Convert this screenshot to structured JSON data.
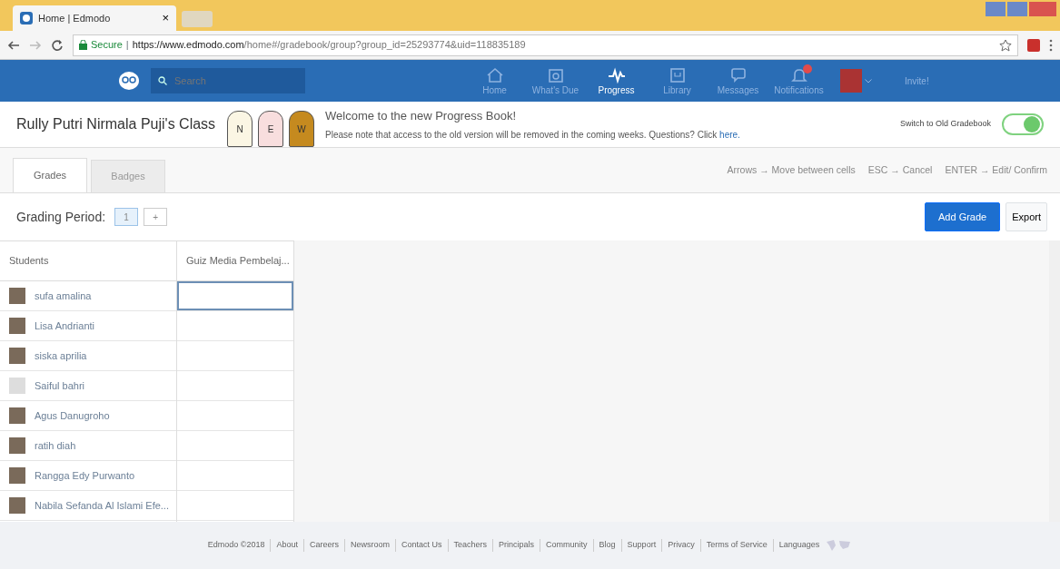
{
  "browser": {
    "tab_title": "Home | Edmodo",
    "tab_close": "×",
    "secure_label": "Secure",
    "separator": "|",
    "url_host": "https://www.edmodo.com",
    "url_path": "/home#/gradebook/group?group_id=25293774&uid=118835189"
  },
  "navbar": {
    "search_placeholder": "Search",
    "items": [
      {
        "label": "Home",
        "selected": false,
        "alert": false
      },
      {
        "label": "What's Due",
        "selected": false,
        "alert": false
      },
      {
        "label": "Progress",
        "selected": true,
        "alert": false
      },
      {
        "label": "Library",
        "selected": false,
        "alert": false
      },
      {
        "label": "Messages",
        "selected": false,
        "alert": false
      },
      {
        "label": "Notifications",
        "selected": false,
        "alert": true
      }
    ],
    "invite": "Invite!"
  },
  "header": {
    "class_name": "Rully Putri Nirmala Puji's Class",
    "banner_letters": [
      "N",
      "E",
      "W"
    ],
    "welcome": "Welcome to the new Progress Book!",
    "note": "Please note that access to the old version will be removed in the coming weeks. Questions? Click ",
    "note_link": "here.",
    "switch_label": "Switch to Old Gradebook",
    "switch_on": true
  },
  "tabs": [
    {
      "label": "Grades",
      "selected": true
    },
    {
      "label": "Badges",
      "selected": false
    }
  ],
  "shortcuts": [
    {
      "key": "Arrows",
      "arrow": "→",
      "action": "Move between cells"
    },
    {
      "key": "ESC",
      "arrow": "→",
      "action": "Cancel"
    },
    {
      "key": "ENTER",
      "arrow": "→",
      "action": "Edit/ Confirm"
    }
  ],
  "grading_period": {
    "label": "Grading Period:",
    "periods": [
      {
        "label": "1",
        "selected": true
      }
    ],
    "add": "+"
  },
  "buttons": [
    "Add Grade",
    "Export"
  ],
  "table": {
    "columns": [
      "Students",
      "Guiz Media Pembelaj..."
    ],
    "rows": [
      {
        "name": "sufa amalina",
        "kind": "photo",
        "selected": true
      },
      {
        "name": "Lisa Andrianti",
        "kind": "photo",
        "selected": false
      },
      {
        "name": "siska aprilia",
        "kind": "photo",
        "selected": false
      },
      {
        "name": "Saiful bahri",
        "kind": "default",
        "selected": false
      },
      {
        "name": "Agus Danugroho",
        "kind": "photo",
        "selected": false
      },
      {
        "name": "ratih diah",
        "kind": "photo",
        "selected": false
      },
      {
        "name": "Rangga Edy Purwanto",
        "kind": "photo",
        "selected": false
      },
      {
        "name": "Nabila Sefanda Al Islami Efe...",
        "kind": "photo",
        "selected": false
      }
    ]
  },
  "footer": {
    "copyright": "Edmodo ©2018",
    "links": [
      "About",
      "Careers",
      "Newsroom",
      "Contact Us",
      "Teachers",
      "Principals",
      "Community",
      "Blog",
      "Support",
      "Privacy",
      "Terms of Service",
      "Languages"
    ]
  }
}
